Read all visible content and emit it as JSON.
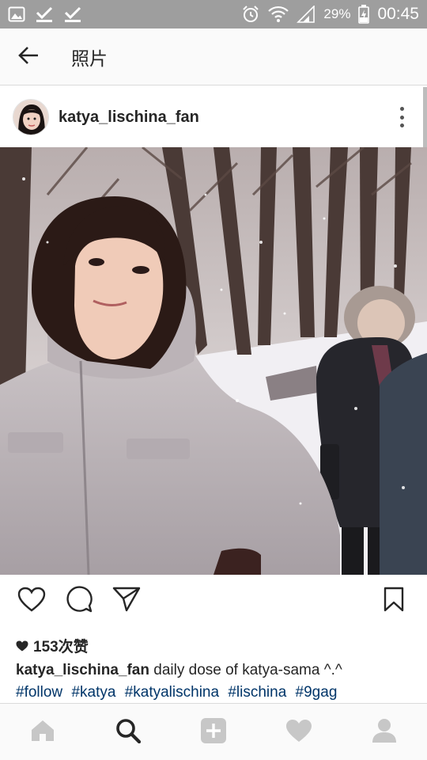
{
  "status_bar": {
    "battery": "29%",
    "time": "00:45",
    "icons": [
      "image-notification-icon",
      "check-icon",
      "check-icon",
      "alarm-icon",
      "wifi-icon",
      "signal-icon",
      "battery-charging-icon"
    ]
  },
  "action_bar": {
    "back_icon": "arrow-left-icon",
    "title": "照片"
  },
  "post": {
    "username": "katya_lischina_fan",
    "avatar_icon": "avatar",
    "more_icon": "more-vertical-icon",
    "photo_icon": "photo",
    "likes": "153次赞",
    "caption_user": "katya_lischina_fan",
    "caption_text": "daily dose of katya-sama ^.^",
    "hashtags": [
      "#follow",
      "#katya",
      "#katyalischina",
      "#lischina",
      "#9gag"
    ]
  },
  "actions": {
    "like_icon": "heart-outline-icon",
    "comment_icon": "comment-icon",
    "share_icon": "send-icon",
    "bookmark_icon": "bookmark-icon"
  },
  "bottom_nav": {
    "items": [
      "home-icon",
      "search-icon",
      "add-icon",
      "heart-icon",
      "profile-icon"
    ]
  },
  "colors": {
    "status_bar": "#9e9e9e",
    "hashtag": "#003569",
    "nav_inactive": "#c7c7c7",
    "nav_active": "#262626"
  }
}
